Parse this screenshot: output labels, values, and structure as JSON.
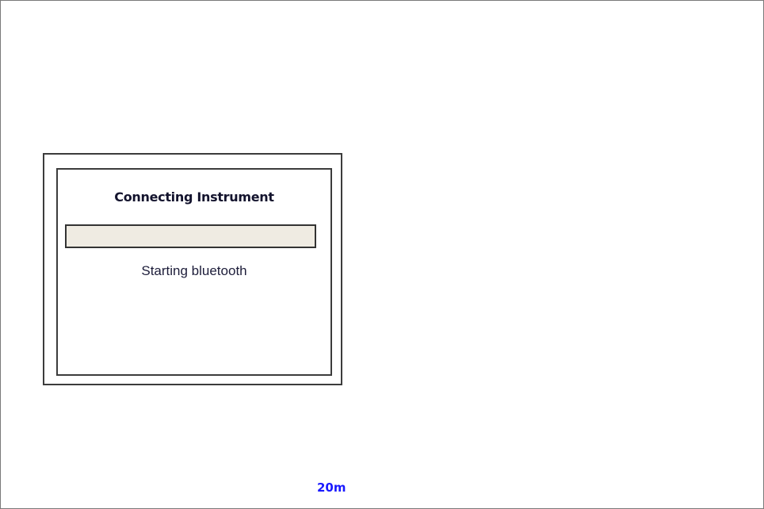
{
  "dialog": {
    "title": "Connecting Instrument",
    "status": "Starting bluetooth",
    "progress": 0
  },
  "map": {
    "scale_label": "20m",
    "scale_color": "#1a1aff"
  }
}
